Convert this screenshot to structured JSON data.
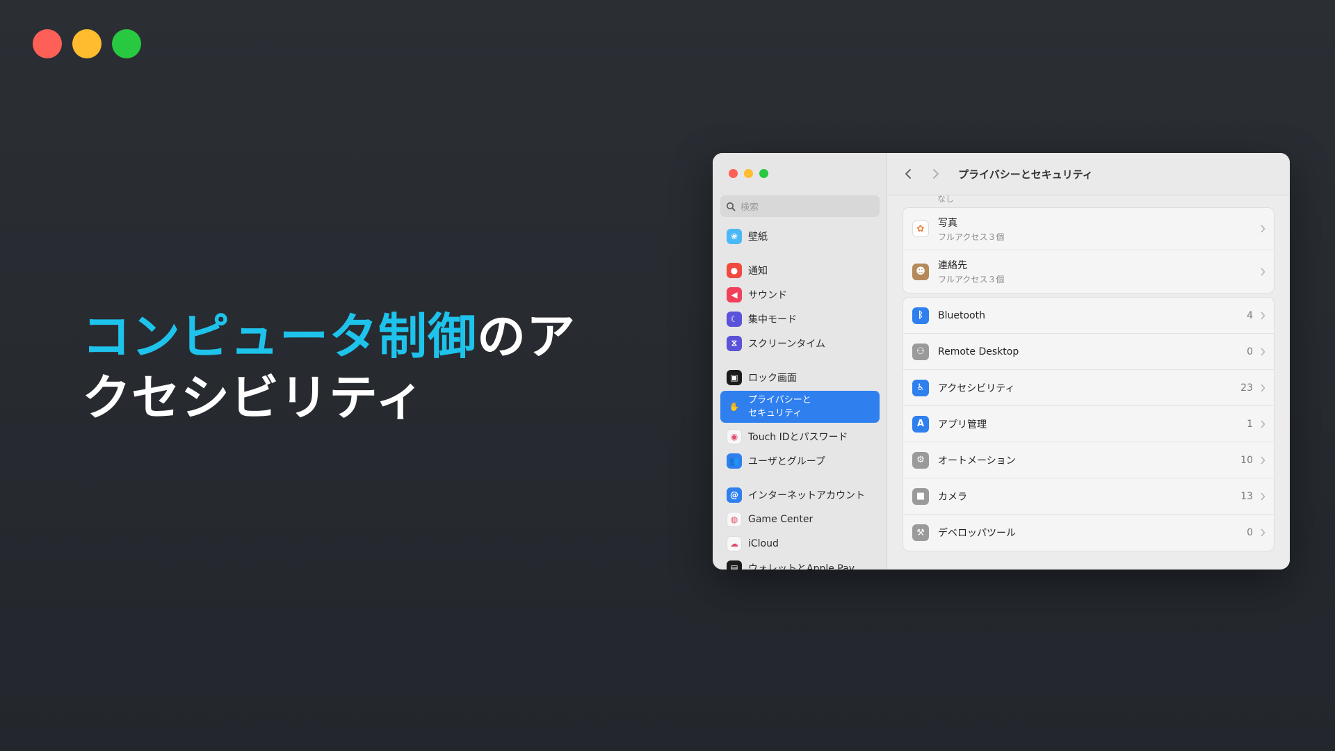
{
  "slide": {
    "headline_accent": "コンピュータ制御",
    "headline_rest": "のアクセシビリティ"
  },
  "colors": {
    "accent": "#1ec3ec",
    "light_red": "#fe5f57",
    "light_yellow": "#febc2e",
    "light_green": "#28c840",
    "selected": "#2f7fef"
  },
  "window": {
    "title": "プライバシーとセキュリティ",
    "search_placeholder": "検索",
    "sidebar": [
      {
        "label": "壁紙",
        "icon": "wallpaper-icon",
        "color": "#4ab8f5",
        "glyph": "❀"
      },
      {
        "label": "通知",
        "icon": "notifications-icon",
        "color": "#f04a3e",
        "glyph": "●"
      },
      {
        "label": "サウンド",
        "icon": "sound-icon",
        "color": "#f0405a",
        "glyph": "◀"
      },
      {
        "label": "集中モード",
        "icon": "focus-moon-icon",
        "color": "#5a52d8",
        "glyph": "☾"
      },
      {
        "label": "スクリーンタイム",
        "icon": "screen-time-icon",
        "color": "#5a52d8",
        "glyph": "⧖"
      },
      {
        "label": "ロック画面",
        "icon": "lock-screen-icon",
        "color": "#1c1c1e",
        "glyph": "▣"
      },
      {
        "label": "プライバシーと\nセキュリティ",
        "icon": "privacy-hand-icon",
        "color": "#2f7fef",
        "glyph": "✋"
      },
      {
        "label": "Touch IDとパスワード",
        "icon": "touch-id-icon",
        "color": "#f7f7f7",
        "glyph": "◉"
      },
      {
        "label": "ユーザとグループ",
        "icon": "users-groups-icon",
        "color": "#2f7fef",
        "glyph": "👥"
      },
      {
        "label": "インターネットアカウント",
        "icon": "internet-accounts-icon",
        "color": "#2f7fef",
        "glyph": "@"
      },
      {
        "label": "Game Center",
        "icon": "game-center-icon",
        "color": "#f7f7f7",
        "glyph": "◍"
      },
      {
        "label": "iCloud",
        "icon": "icloud-icon",
        "color": "#f7f7f7",
        "glyph": "☁"
      },
      {
        "label": "ウォレットとApple Pay",
        "icon": "wallet-icon",
        "color": "#1c1c1e",
        "glyph": "▤"
      }
    ],
    "cut_off_text": "なし",
    "group1": [
      {
        "title": "写真",
        "sub": "フルアクセス３個",
        "icon": "photos-icon",
        "color": "#ffffff",
        "glyph": "✿"
      },
      {
        "title": "連絡先",
        "sub": "フルアクセス３個",
        "icon": "contacts-icon",
        "color": "#b5895a",
        "glyph": "☻"
      }
    ],
    "group2": [
      {
        "title": "Bluetooth",
        "count": "4",
        "icon": "bluetooth-icon",
        "color": "#2f7fef",
        "glyph": "ᛒ"
      },
      {
        "title": "Remote Desktop",
        "count": "0",
        "icon": "remote-desktop-icon",
        "color": "#9a9a9a",
        "glyph": "⚇"
      },
      {
        "title": "アクセシビリティ",
        "count": "23",
        "icon": "accessibility-icon",
        "color": "#2f7fef",
        "glyph": "♿"
      },
      {
        "title": "アプリ管理",
        "count": "1",
        "icon": "app-store-icon",
        "color": "#2f7fef",
        "glyph": "A"
      },
      {
        "title": "オートメーション",
        "count": "10",
        "icon": "automation-gear-icon",
        "color": "#9a9a9a",
        "glyph": "⚙"
      },
      {
        "title": "カメラ",
        "count": "13",
        "icon": "camera-icon",
        "color": "#9a9a9a",
        "glyph": "■"
      },
      {
        "title": "デベロッパツール",
        "count": "0",
        "icon": "developer-tools-icon",
        "color": "#9a9a9a",
        "glyph": "⚒"
      }
    ]
  }
}
